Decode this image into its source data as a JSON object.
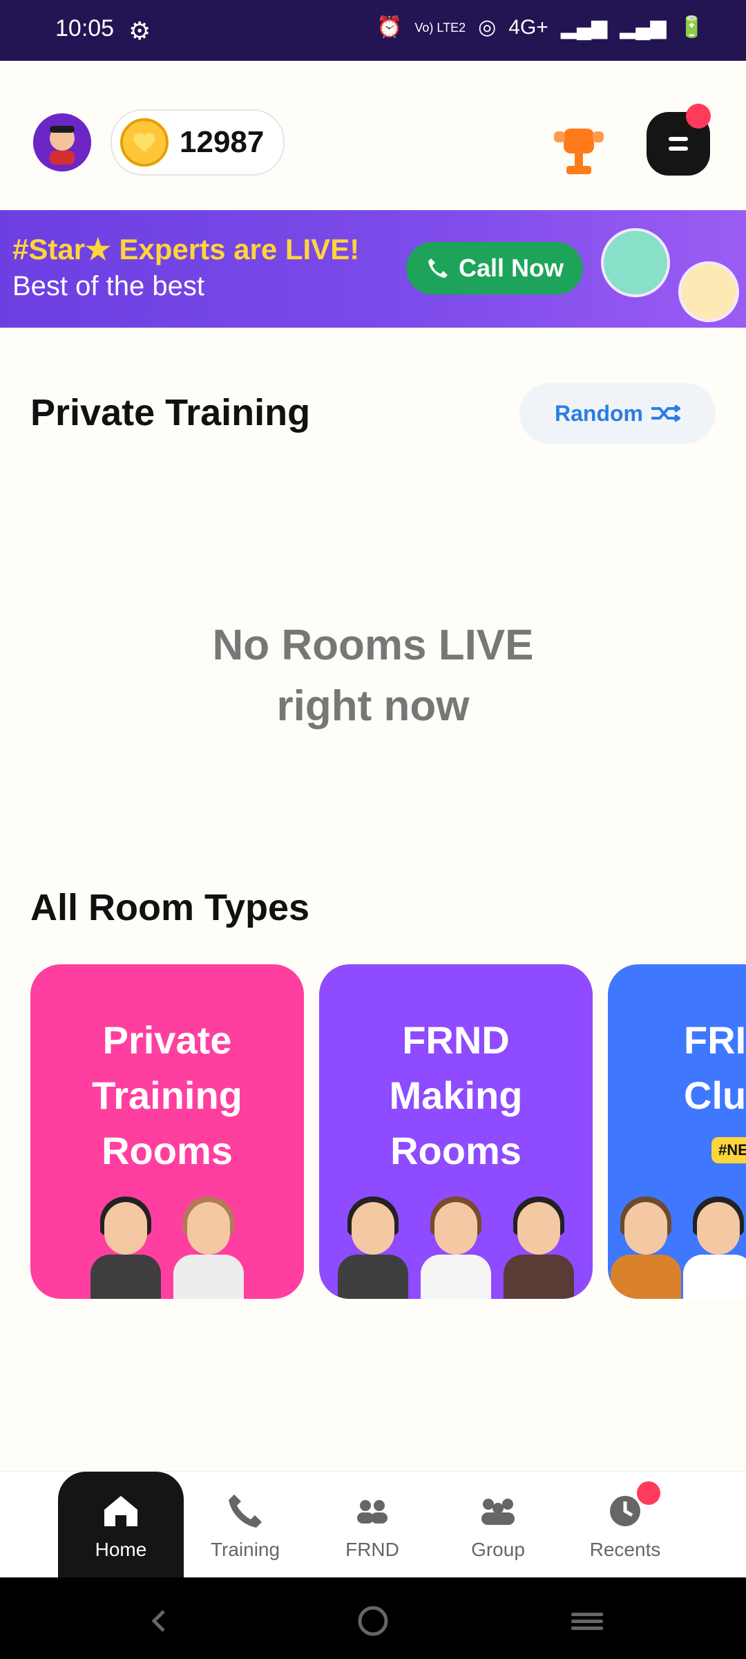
{
  "status_bar": {
    "time": "10:05",
    "network": "4G+",
    "volte": "Vo) LTE2"
  },
  "header": {
    "coins": "12987"
  },
  "banner": {
    "title": "#Star★ Experts are LIVE!",
    "subtitle": "Best of the best",
    "cta": "Call Now"
  },
  "private_training": {
    "title": "Private Training",
    "random_label": "Random"
  },
  "empty_state": {
    "line1": "No Rooms LIVE",
    "line2": "right now"
  },
  "room_types": {
    "title": "All Room Types",
    "cards": [
      {
        "title_lines": [
          "Private",
          "Training",
          "Rooms"
        ],
        "color": "#FF3FA0"
      },
      {
        "title_lines": [
          "FRND",
          "Making",
          "Rooms"
        ],
        "color": "#8E4BFF"
      },
      {
        "title_lines": [
          "FRI",
          "Clu"
        ],
        "color": "#3F78FF",
        "tag": "#NE"
      }
    ]
  },
  "bottom_nav": {
    "items": [
      {
        "label": "Home",
        "active": true
      },
      {
        "label": "Training"
      },
      {
        "label": "FRND"
      },
      {
        "label": "Group"
      },
      {
        "label": "Recents"
      }
    ]
  },
  "colors": {
    "accent": "#2A7EE2",
    "statusbar": "#231453",
    "banner": "#7C4BE9"
  }
}
